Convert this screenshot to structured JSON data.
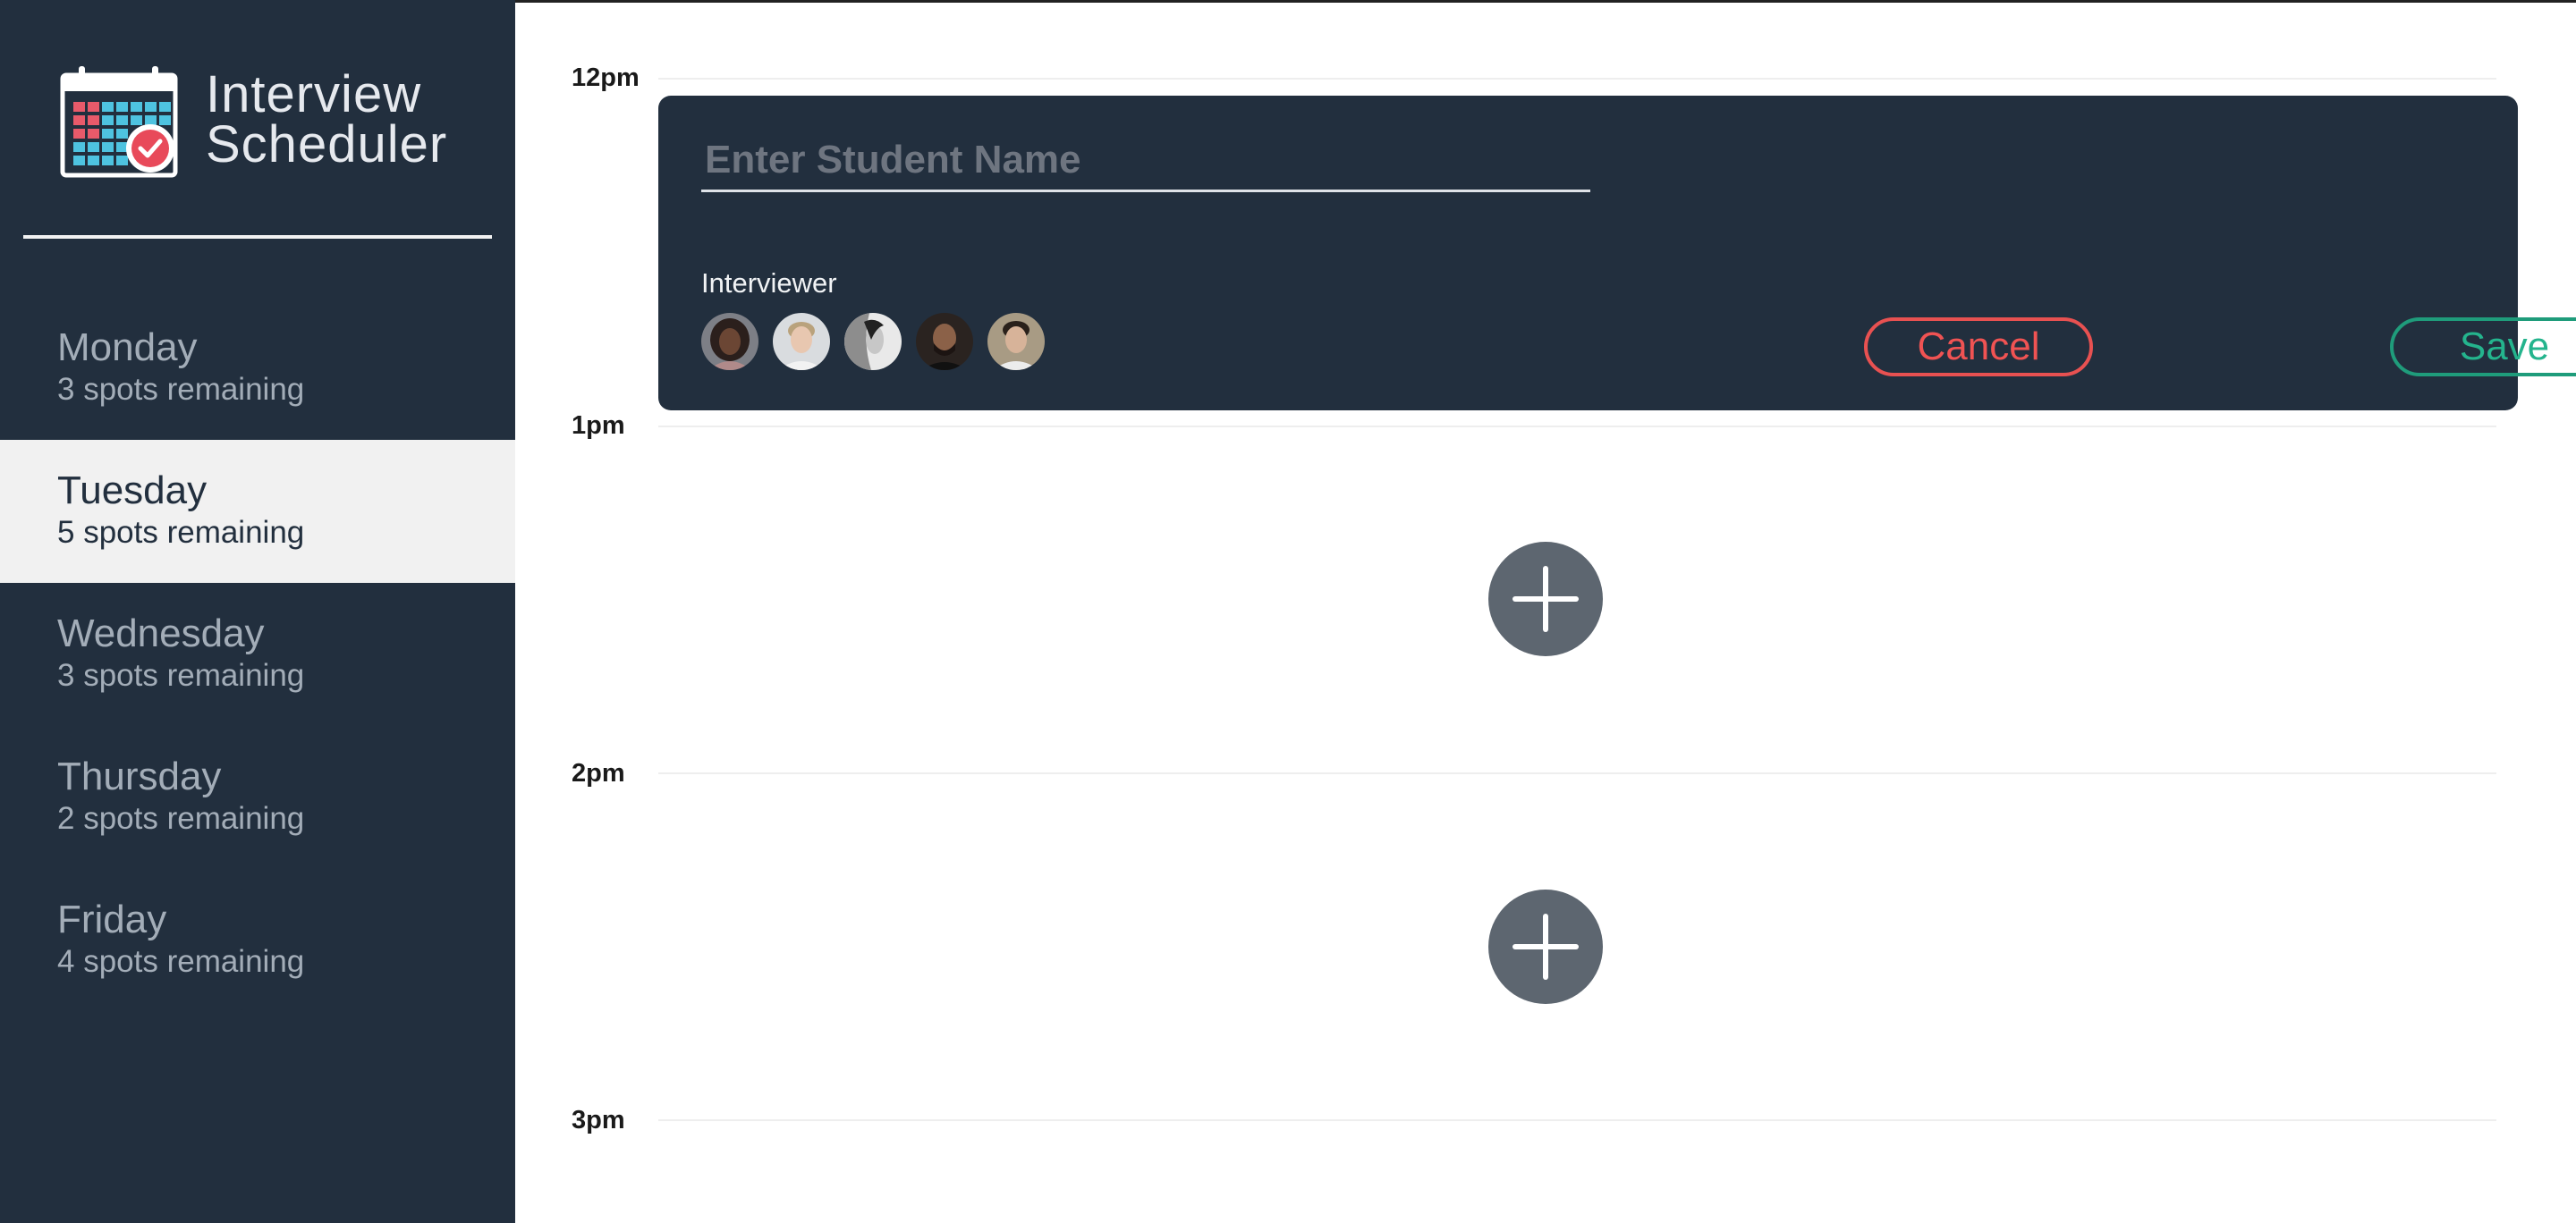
{
  "app": {
    "title_line1": "Interview",
    "title_line2": "Scheduler",
    "logo_icon": "calendar-check-icon"
  },
  "sidebar": {
    "days": [
      {
        "name": "Monday",
        "spots": "3 spots remaining",
        "selected": false
      },
      {
        "name": "Tuesday",
        "spots": "5 spots remaining",
        "selected": true
      },
      {
        "name": "Wednesday",
        "spots": "3 spots remaining",
        "selected": false
      },
      {
        "name": "Thursday",
        "spots": "2 spots remaining",
        "selected": false
      },
      {
        "name": "Friday",
        "spots": "4 spots remaining",
        "selected": false
      }
    ]
  },
  "schedule": {
    "times": [
      "12pm",
      "1pm",
      "2pm",
      "3pm"
    ],
    "form": {
      "student_value": "",
      "student_placeholder": "Enter Student Name",
      "interviewer_label": "Interviewer",
      "interviewers": [
        "interviewer-avatar-1",
        "interviewer-avatar-2",
        "interviewer-avatar-3",
        "interviewer-avatar-4",
        "interviewer-avatar-5"
      ],
      "cancel_label": "Cancel",
      "save_label": "Save"
    },
    "add_icon": "plus-icon"
  },
  "colors": {
    "sidebar_bg": "#222f3e",
    "selected_bg": "#f1f1f1",
    "cancel": "#f05353",
    "save": "#24b48d",
    "add_button": "#5d6670"
  }
}
